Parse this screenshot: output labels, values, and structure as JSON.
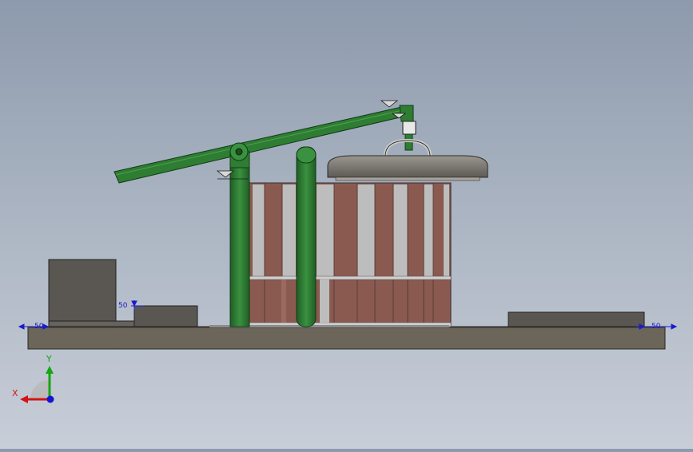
{
  "dimensions": {
    "left_height": "50",
    "left_base": "50",
    "right_base": "50"
  },
  "triad": {
    "x_label": "X",
    "y_label": "Y",
    "x_color": "#d21414",
    "y_color": "#14a614",
    "z_color": "#1414d2"
  },
  "colors": {
    "frame_green": "#2e7d32",
    "frame_green_dark": "#1b4d1f",
    "brick": "#8a5a50",
    "gray_panel": "#b8b8b8",
    "base": "#6b6659",
    "block": "#5a5752"
  }
}
